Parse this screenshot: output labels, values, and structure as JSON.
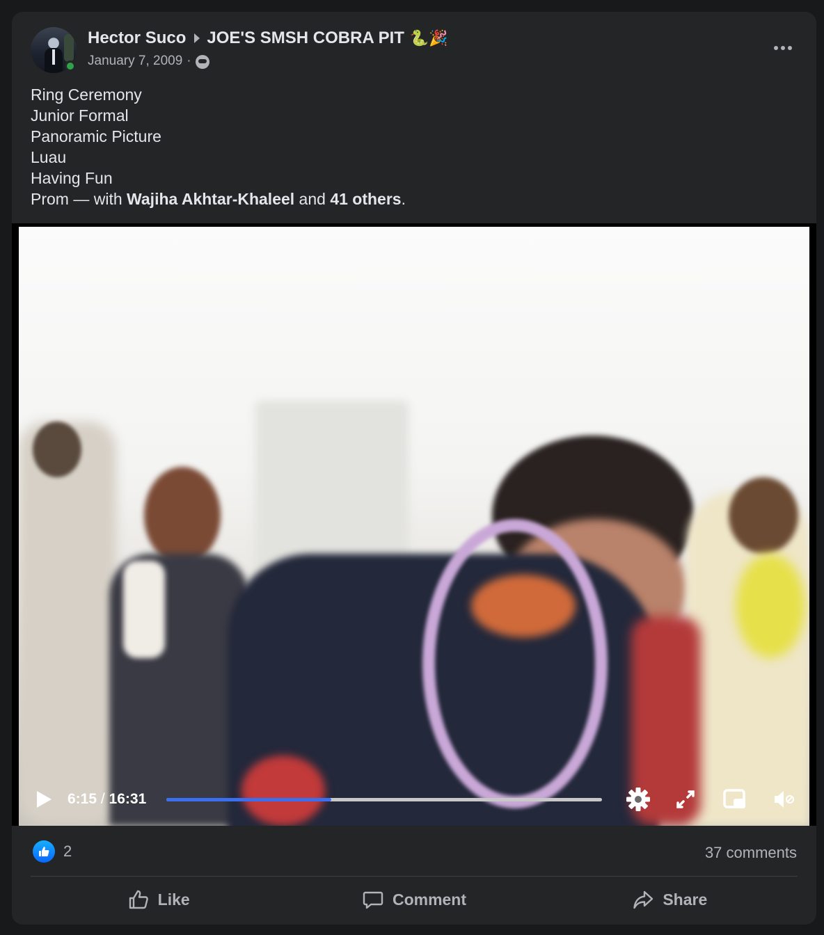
{
  "post": {
    "author": "Hector Suco",
    "group": "JOE'S SMSH COBRA PIT",
    "group_emoji": "🐍🎉",
    "date": "January 7, 2009",
    "date_separator": "·",
    "caption_lines": [
      "Ring Ceremony",
      "Junior Formal",
      "Panoramic Picture",
      "Luau",
      "Having Fun"
    ],
    "last_line_prefix": "Prom — with ",
    "tagged_name": "Wajiha Akhtar-Khaleel",
    "tagged_joiner": " and ",
    "tagged_others": "41 others",
    "tagged_suffix": "."
  },
  "video": {
    "current_time": "6:15",
    "time_separator": " / ",
    "duration": "16:31",
    "progress_fraction": 0.378,
    "buffered_fraction": 0.47
  },
  "reactions": {
    "count": "2",
    "comments": "37 comments"
  },
  "actions": {
    "like": "Like",
    "comment": "Comment",
    "share": "Share"
  },
  "colors": {
    "card": "#242526",
    "accent_blue": "#3b6ff0",
    "online_green": "#31a24c",
    "secondary_text": "#b0b3b8"
  },
  "icons": {
    "audience": "friends-icon",
    "more": "more-horizontal-icon",
    "play": "play-icon",
    "settings": "gear-icon",
    "expand": "expand-icon",
    "pip": "picture-in-picture-icon",
    "mute": "volume-muted-icon",
    "like_reaction": "thumbs-up-icon"
  }
}
